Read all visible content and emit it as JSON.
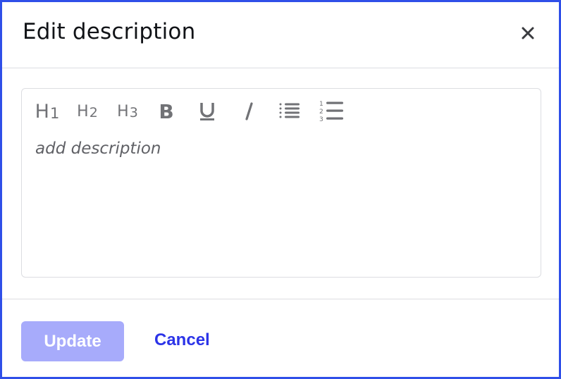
{
  "dialog": {
    "title": "Edit description",
    "close_icon": "close-icon"
  },
  "toolbar": {
    "h1": {
      "label": "H",
      "level": "1",
      "icon": "heading-1-icon"
    },
    "h2": {
      "label": "H",
      "level": "2",
      "icon": "heading-2-icon"
    },
    "h3": {
      "label": "H",
      "level": "3",
      "icon": "heading-3-icon"
    },
    "bold": {
      "label": "B",
      "icon": "bold-icon"
    },
    "underline": {
      "label": "U",
      "icon": "underline-icon"
    },
    "italic": {
      "label": "I",
      "icon": "italic-icon"
    },
    "bullet_list": {
      "icon": "bullet-list-icon"
    },
    "ordered_list": {
      "icon": "ordered-list-icon",
      "numbers": [
        "1",
        "2",
        "3"
      ]
    }
  },
  "editor": {
    "placeholder": "add description"
  },
  "footer": {
    "update_label": "Update",
    "cancel_label": "Cancel"
  },
  "colors": {
    "border_accent": "#2f4fe8",
    "update_button_disabled": "#a7abfb",
    "cancel_link": "#2c34e8"
  }
}
